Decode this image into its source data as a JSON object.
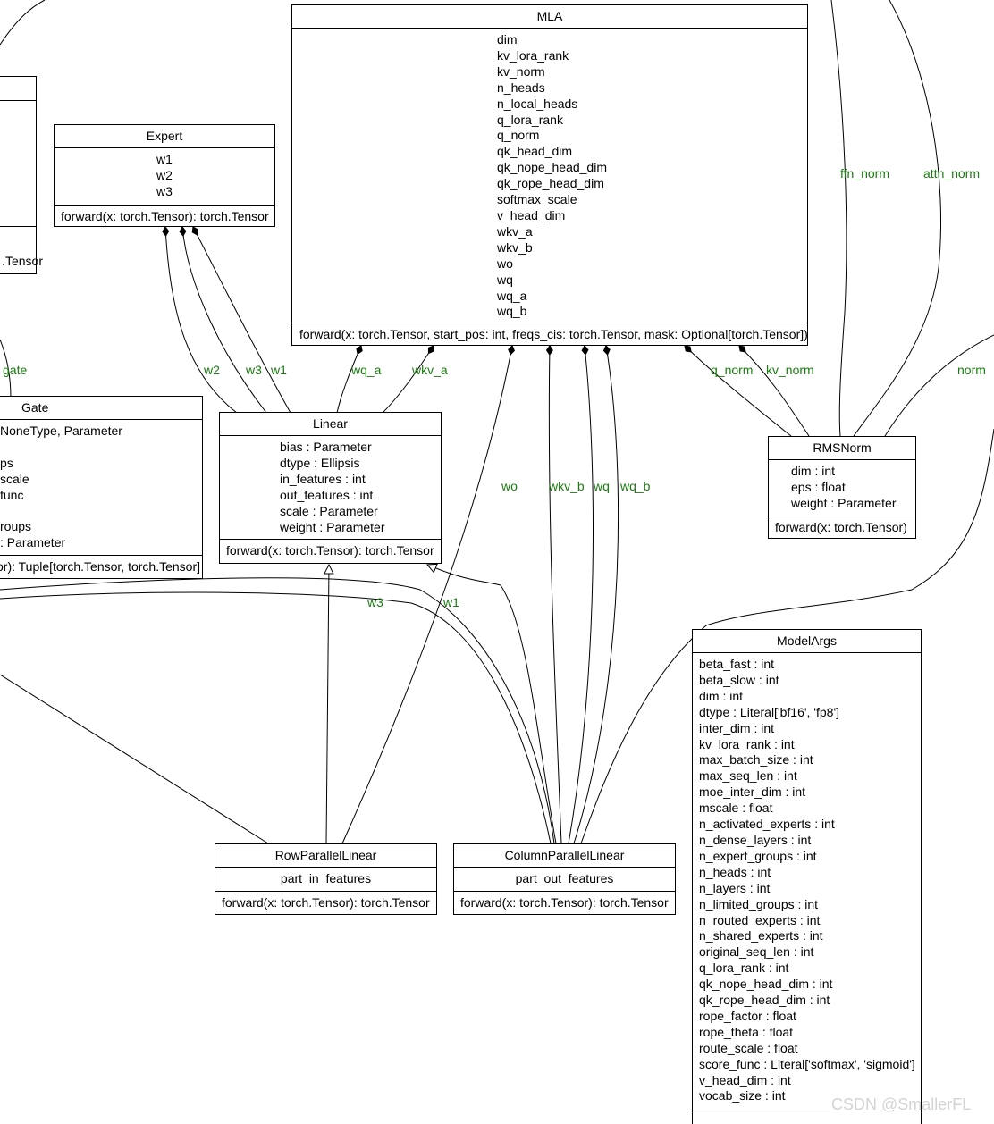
{
  "classes": {
    "mla": {
      "name": "MLA",
      "attrs": [
        "dim",
        "kv_lora_rank",
        "kv_norm",
        "n_heads",
        "n_local_heads",
        "q_lora_rank",
        "q_norm",
        "qk_head_dim",
        "qk_nope_head_dim",
        "qk_rope_head_dim",
        "softmax_scale",
        "v_head_dim",
        "wkv_a",
        "wkv_b",
        "wo",
        "wq",
        "wq_a",
        "wq_b"
      ],
      "method": "forward(x: torch.Tensor, start_pos: int, freqs_cis: torch.Tensor, mask: Optional[torch.Tensor])"
    },
    "expert": {
      "name": "Expert",
      "attrs": [
        "w1",
        "w2",
        "w3"
      ],
      "method": "forward(x: torch.Tensor): torch.Tensor"
    },
    "left_partial": {
      "method": ".Tensor"
    },
    "gate": {
      "name": "Gate",
      "attrs": [
        "NoneType, Parameter",
        "",
        "ps",
        "scale",
        "func",
        "",
        "roups",
        ": Parameter"
      ],
      "method": "or): Tuple[torch.Tensor, torch.Tensor]"
    },
    "linear": {
      "name": "Linear",
      "attrs": [
        "bias : Parameter",
        "dtype : Ellipsis",
        "in_features : int",
        "out_features : int",
        "scale : Parameter",
        "weight : Parameter"
      ],
      "method": "forward(x: torch.Tensor): torch.Tensor"
    },
    "rmsnorm": {
      "name": "RMSNorm",
      "attrs": [
        "dim : int",
        "eps : float",
        "weight : Parameter"
      ],
      "method": "forward(x: torch.Tensor)"
    },
    "rowparallel": {
      "name": "RowParallelLinear",
      "attrs": [
        "part_in_features"
      ],
      "method": "forward(x: torch.Tensor): torch.Tensor"
    },
    "columnparallel": {
      "name": "ColumnParallelLinear",
      "attrs": [
        "part_out_features"
      ],
      "method": "forward(x: torch.Tensor): torch.Tensor"
    },
    "modelargs": {
      "name": "ModelArgs",
      "attrs": [
        "beta_fast : int",
        "beta_slow : int",
        "dim : int",
        "dtype : Literal['bf16', 'fp8']",
        "inter_dim : int",
        "kv_lora_rank : int",
        "max_batch_size : int",
        "max_seq_len : int",
        "moe_inter_dim : int",
        "mscale : float",
        "n_activated_experts : int",
        "n_dense_layers : int",
        "n_expert_groups : int",
        "n_heads : int",
        "n_layers : int",
        "n_limited_groups : int",
        "n_routed_experts : int",
        "n_shared_experts : int",
        "original_seq_len : int",
        "q_lora_rank : int",
        "qk_nope_head_dim : int",
        "qk_rope_head_dim : int",
        "rope_factor : float",
        "rope_theta : float",
        "route_scale : float",
        "score_func : Literal['softmax', 'sigmoid']",
        "v_head_dim : int",
        "vocab_size : int"
      ]
    }
  },
  "edge_labels": {
    "ffn_norm": "ffn_norm",
    "attn_norm": "attn_norm",
    "gate": "gate",
    "w2": "w2",
    "w3_expert": "w3",
    "w1_expert": "w1",
    "wq_a": "wq_a",
    "wkv_a": "wkv_a",
    "q_norm": "q_norm",
    "kv_norm": "kv_norm",
    "norm": "norm",
    "wo": "wo",
    "wkv_b": "wkv_b",
    "wq": "wq",
    "wq_b": "wq_b",
    "w3_lower": "w3",
    "w1_lower": "w1"
  },
  "watermark": "CSDN @SmallerFL",
  "colors": {
    "label": "#1a7c10",
    "line": "#000000",
    "watermark": "#d3d3d3"
  }
}
